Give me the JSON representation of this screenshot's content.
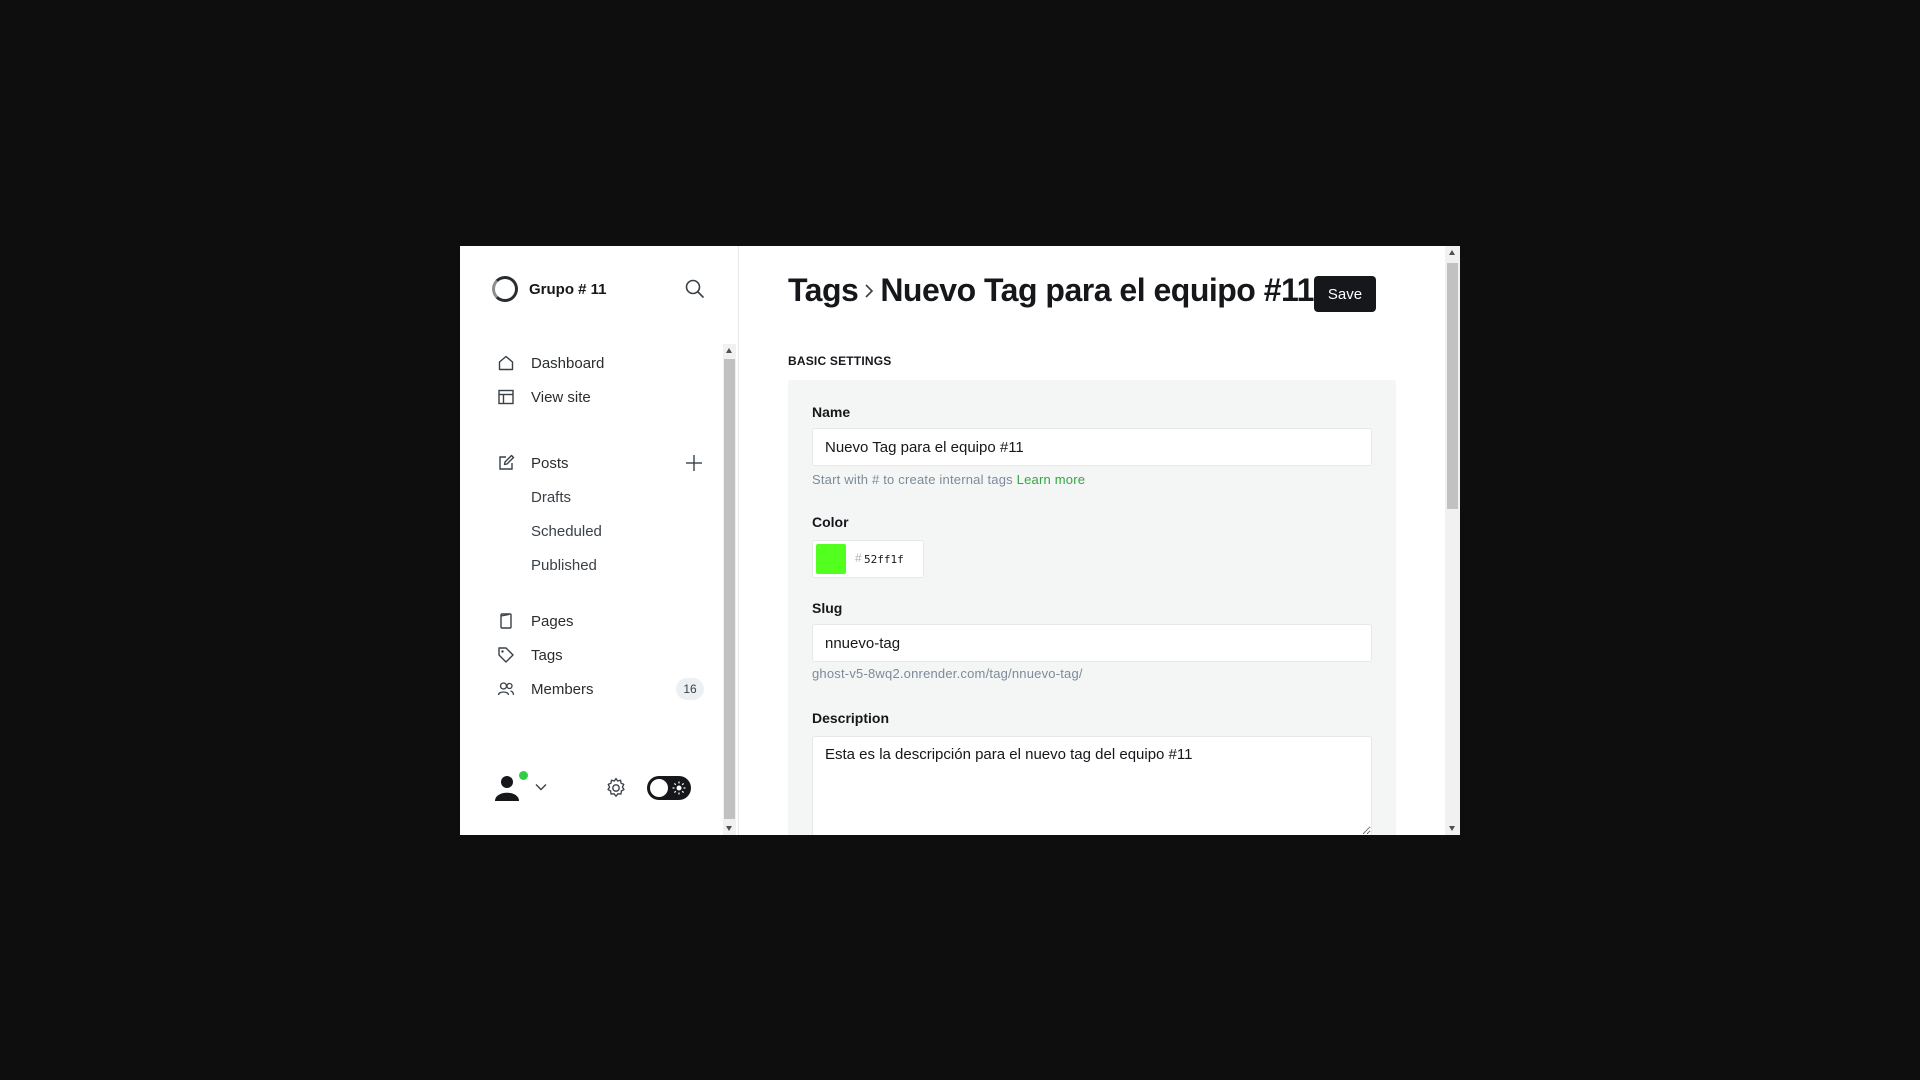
{
  "sidebar": {
    "site_name": "Grupo # 11",
    "nav_primary": [
      {
        "label": "Dashboard",
        "icon": "home-icon"
      },
      {
        "label": "View site",
        "icon": "layout-icon"
      }
    ],
    "posts": {
      "label": "Posts",
      "icon": "edit-icon",
      "sub": [
        "Drafts",
        "Scheduled",
        "Published"
      ]
    },
    "nav_secondary": [
      {
        "label": "Pages",
        "icon": "page-icon"
      },
      {
        "label": "Tags",
        "icon": "tag-icon"
      },
      {
        "label": "Members",
        "icon": "members-icon",
        "count": "16"
      }
    ]
  },
  "header": {
    "breadcrumb_parent": "Tags",
    "title": "Nuevo Tag para el equipo #11",
    "save_label": "Save"
  },
  "basic_settings": {
    "section_label": "BASIC SETTINGS",
    "name_label": "Name",
    "name_value": "Nuevo Tag para el equipo #11",
    "name_hint": "Start with # to create internal tags",
    "name_hint_link": "Learn more",
    "color_label": "Color",
    "color_hash": "#",
    "color_value": "52ff1f",
    "color_swatch": "#52ff1f",
    "slug_label": "Slug",
    "slug_value": "nnuevo-tag",
    "slug_url": "ghost-v5-8wq2.onrender.com/tag/nnuevo-tag/",
    "description_label": "Description",
    "description_value": "Esta es la descripción para el nuevo tag del equipo #11"
  },
  "colors": {
    "accent_green": "#30a83e",
    "online": "#30cf43",
    "dark": "#15171a"
  }
}
